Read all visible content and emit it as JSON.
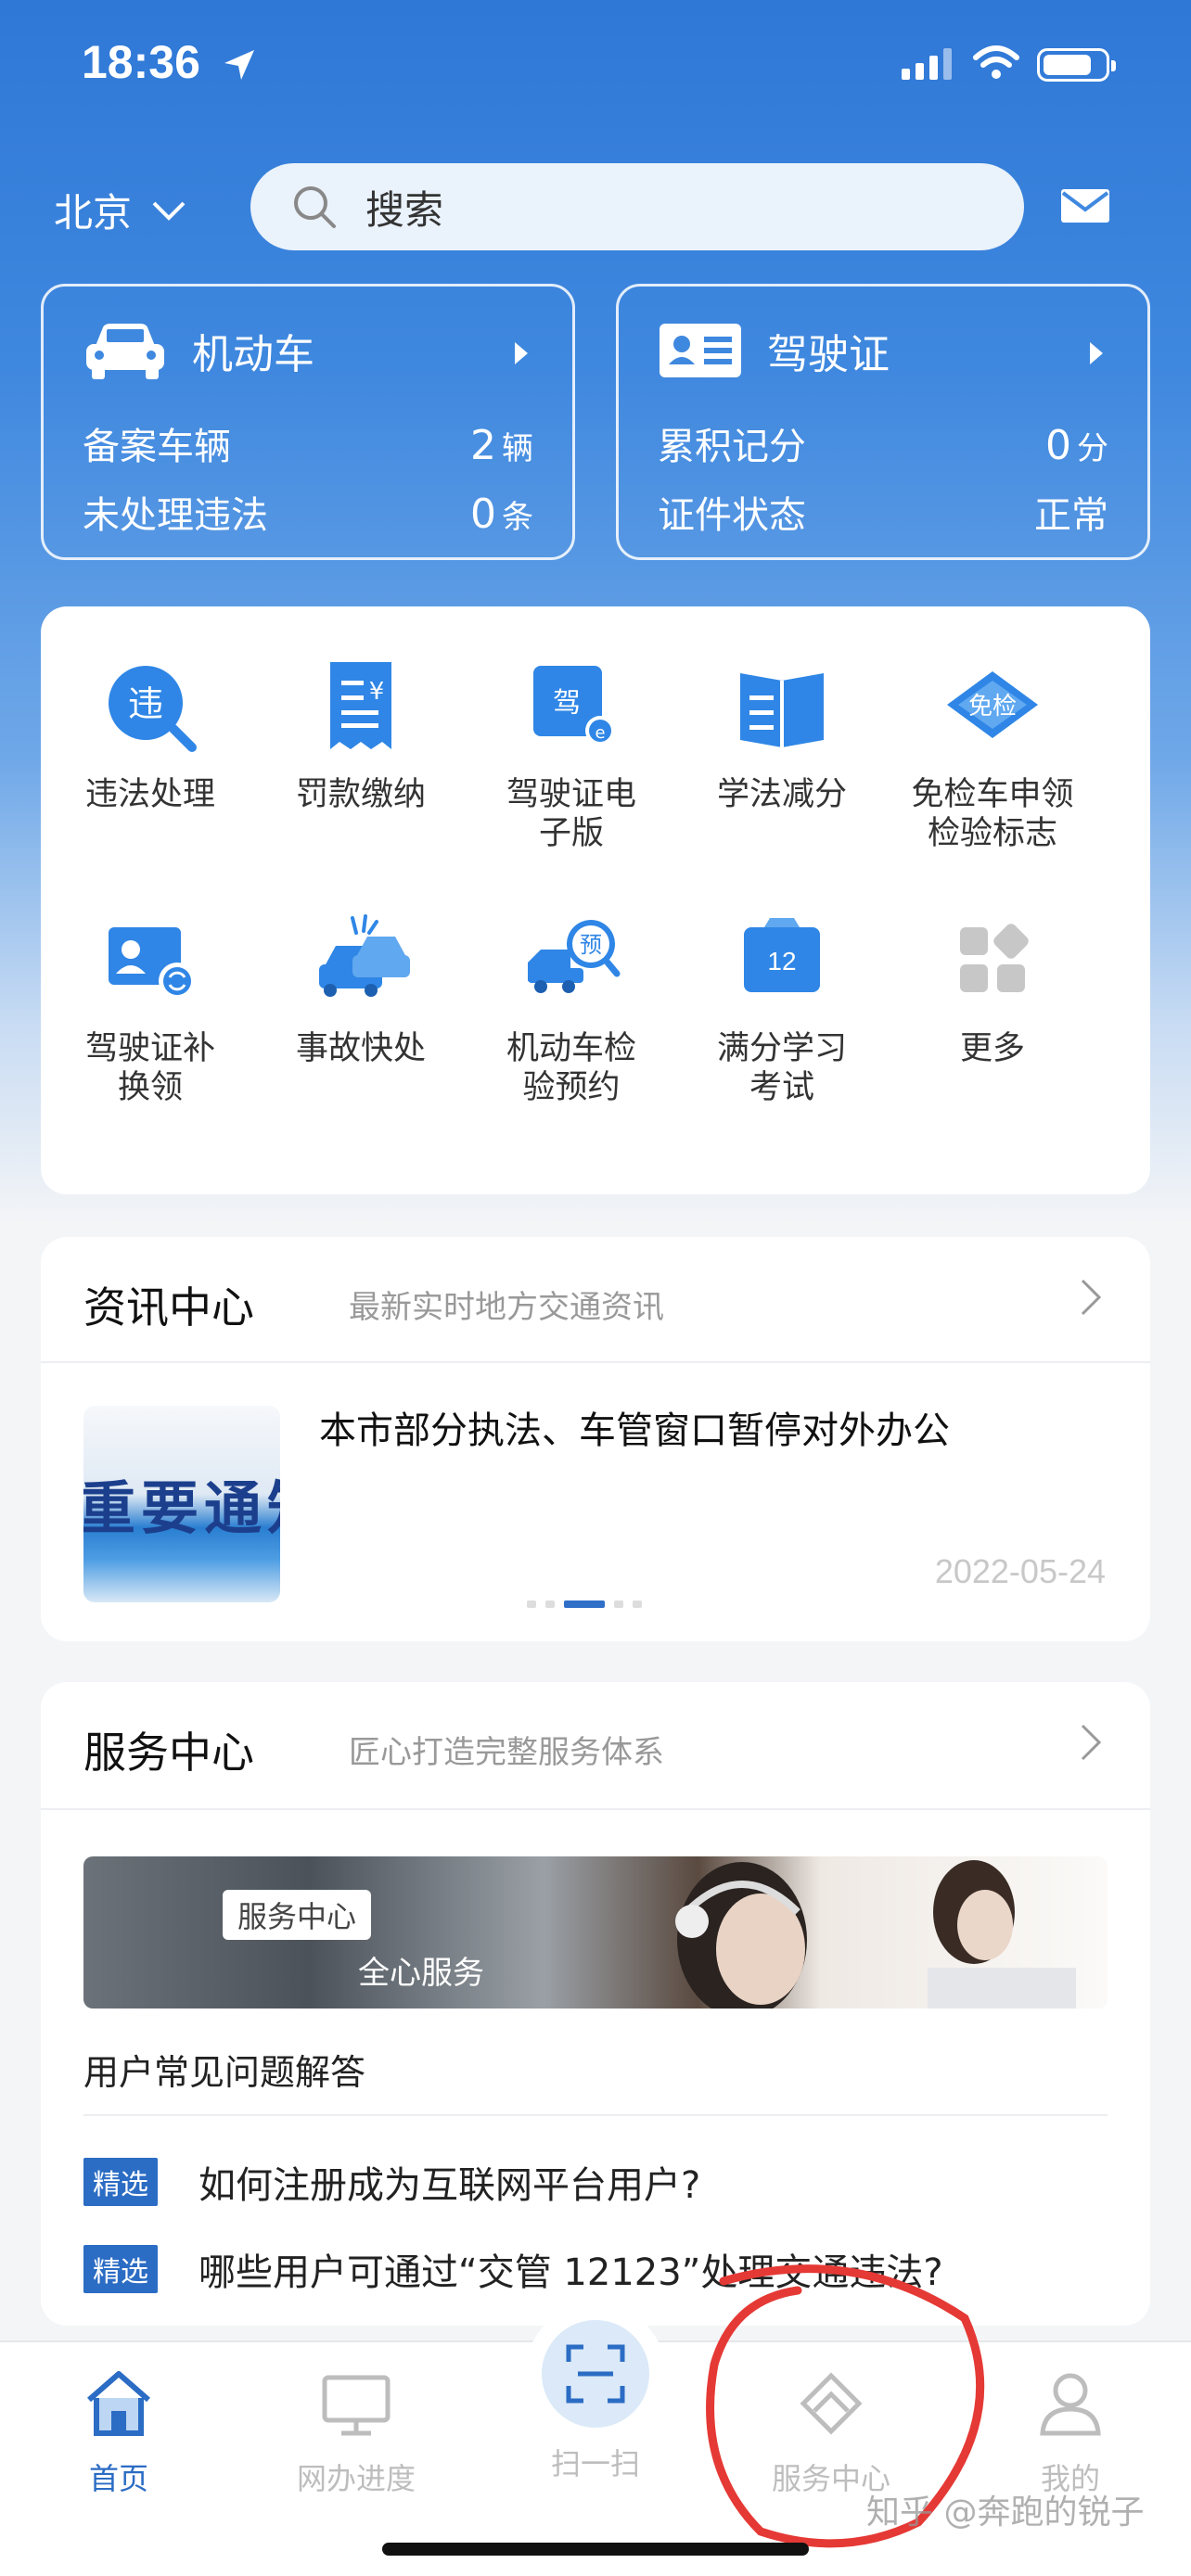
{
  "status_bar": {
    "time": "18:36",
    "battery_level": 0.8
  },
  "top_bar": {
    "city": "北京",
    "search_placeholder": "搜索"
  },
  "vehicle_card": {
    "title": "机动车",
    "rows": [
      {
        "label": "备案车辆",
        "value": "2",
        "unit": "辆"
      },
      {
        "label": "未处理违法",
        "value": "0",
        "unit": "条"
      }
    ]
  },
  "license_card": {
    "title": "驾驶证",
    "rows": [
      {
        "label": "累积记分",
        "value": "0",
        "unit": "分"
      },
      {
        "label": "证件状态",
        "value": "正常",
        "unit": ""
      }
    ]
  },
  "services": [
    {
      "label": "违法处理",
      "icon": "violation-icon"
    },
    {
      "label": "罚款缴纳",
      "icon": "fine-payment-icon"
    },
    {
      "label": "驾驶证电\n子版",
      "icon": "e-license-icon"
    },
    {
      "label": "学法减分",
      "icon": "study-book-icon"
    },
    {
      "label": "免检车申领\n检验标志",
      "icon": "exempt-inspection-icon"
    },
    {
      "label": "驾驶证补\n换领",
      "icon": "license-renew-icon"
    },
    {
      "label": "事故快处",
      "icon": "accident-icon"
    },
    {
      "label": "机动车检\n验预约",
      "icon": "inspection-booking-icon"
    },
    {
      "label": "满分学习\n考试",
      "icon": "full-score-exam-icon"
    },
    {
      "label": "更多",
      "icon": "more-grid-icon"
    }
  ],
  "news": {
    "title": "资讯中心",
    "subtitle": "最新实时地方交通资讯",
    "thumb_text": "重要通知",
    "item_title": "本市部分执法、车管窗口暂停对外办公",
    "date": "2022-05-24"
  },
  "service_center": {
    "title": "服务中心",
    "subtitle": "匠心打造完整服务体系",
    "banner_tag": "服务中心",
    "banner_text": "全心服务",
    "faq_title": "用户常见问题解答",
    "faqs": [
      {
        "badge": "精选",
        "text": "如何注册成为互联网平台用户?"
      },
      {
        "badge": "精选",
        "text": "哪些用户可通过“交管 12123”处理交通违法?"
      }
    ]
  },
  "tabs": {
    "home": "首页",
    "progress": "网办进度",
    "scan": "扫一扫",
    "service": "服务中心",
    "mine": "我的"
  },
  "watermark": "知乎 @奔跑的锐子",
  "colors": {
    "primary": "#2b6cc4",
    "annotation": "#e53935"
  }
}
